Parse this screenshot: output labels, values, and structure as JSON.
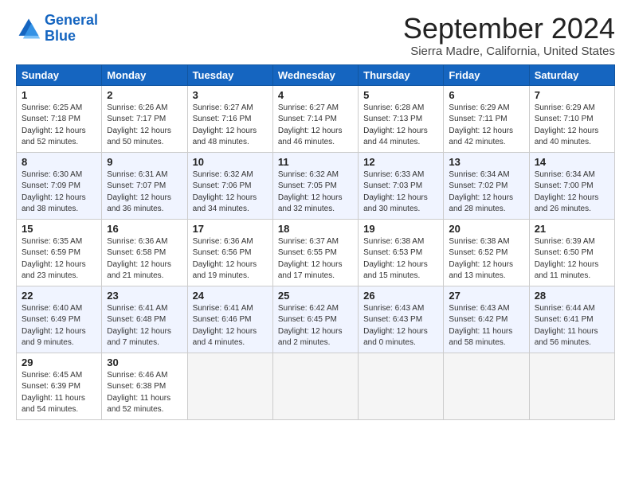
{
  "header": {
    "logo_line1": "General",
    "logo_line2": "Blue",
    "month": "September 2024",
    "location": "Sierra Madre, California, United States"
  },
  "days_of_week": [
    "Sunday",
    "Monday",
    "Tuesday",
    "Wednesday",
    "Thursday",
    "Friday",
    "Saturday"
  ],
  "weeks": [
    [
      {
        "num": "1",
        "rise": "6:25 AM",
        "set": "7:18 PM",
        "daylight": "12 hours and 52 minutes."
      },
      {
        "num": "2",
        "rise": "6:26 AM",
        "set": "7:17 PM",
        "daylight": "12 hours and 50 minutes."
      },
      {
        "num": "3",
        "rise": "6:27 AM",
        "set": "7:16 PM",
        "daylight": "12 hours and 48 minutes."
      },
      {
        "num": "4",
        "rise": "6:27 AM",
        "set": "7:14 PM",
        "daylight": "12 hours and 46 minutes."
      },
      {
        "num": "5",
        "rise": "6:28 AM",
        "set": "7:13 PM",
        "daylight": "12 hours and 44 minutes."
      },
      {
        "num": "6",
        "rise": "6:29 AM",
        "set": "7:11 PM",
        "daylight": "12 hours and 42 minutes."
      },
      {
        "num": "7",
        "rise": "6:29 AM",
        "set": "7:10 PM",
        "daylight": "12 hours and 40 minutes."
      }
    ],
    [
      {
        "num": "8",
        "rise": "6:30 AM",
        "set": "7:09 PM",
        "daylight": "12 hours and 38 minutes."
      },
      {
        "num": "9",
        "rise": "6:31 AM",
        "set": "7:07 PM",
        "daylight": "12 hours and 36 minutes."
      },
      {
        "num": "10",
        "rise": "6:32 AM",
        "set": "7:06 PM",
        "daylight": "12 hours and 34 minutes."
      },
      {
        "num": "11",
        "rise": "6:32 AM",
        "set": "7:05 PM",
        "daylight": "12 hours and 32 minutes."
      },
      {
        "num": "12",
        "rise": "6:33 AM",
        "set": "7:03 PM",
        "daylight": "12 hours and 30 minutes."
      },
      {
        "num": "13",
        "rise": "6:34 AM",
        "set": "7:02 PM",
        "daylight": "12 hours and 28 minutes."
      },
      {
        "num": "14",
        "rise": "6:34 AM",
        "set": "7:00 PM",
        "daylight": "12 hours and 26 minutes."
      }
    ],
    [
      {
        "num": "15",
        "rise": "6:35 AM",
        "set": "6:59 PM",
        "daylight": "12 hours and 23 minutes."
      },
      {
        "num": "16",
        "rise": "6:36 AM",
        "set": "6:58 PM",
        "daylight": "12 hours and 21 minutes."
      },
      {
        "num": "17",
        "rise": "6:36 AM",
        "set": "6:56 PM",
        "daylight": "12 hours and 19 minutes."
      },
      {
        "num": "18",
        "rise": "6:37 AM",
        "set": "6:55 PM",
        "daylight": "12 hours and 17 minutes."
      },
      {
        "num": "19",
        "rise": "6:38 AM",
        "set": "6:53 PM",
        "daylight": "12 hours and 15 minutes."
      },
      {
        "num": "20",
        "rise": "6:38 AM",
        "set": "6:52 PM",
        "daylight": "12 hours and 13 minutes."
      },
      {
        "num": "21",
        "rise": "6:39 AM",
        "set": "6:50 PM",
        "daylight": "12 hours and 11 minutes."
      }
    ],
    [
      {
        "num": "22",
        "rise": "6:40 AM",
        "set": "6:49 PM",
        "daylight": "12 hours and 9 minutes."
      },
      {
        "num": "23",
        "rise": "6:41 AM",
        "set": "6:48 PM",
        "daylight": "12 hours and 7 minutes."
      },
      {
        "num": "24",
        "rise": "6:41 AM",
        "set": "6:46 PM",
        "daylight": "12 hours and 4 minutes."
      },
      {
        "num": "25",
        "rise": "6:42 AM",
        "set": "6:45 PM",
        "daylight": "12 hours and 2 minutes."
      },
      {
        "num": "26",
        "rise": "6:43 AM",
        "set": "6:43 PM",
        "daylight": "12 hours and 0 minutes."
      },
      {
        "num": "27",
        "rise": "6:43 AM",
        "set": "6:42 PM",
        "daylight": "11 hours and 58 minutes."
      },
      {
        "num": "28",
        "rise": "6:44 AM",
        "set": "6:41 PM",
        "daylight": "11 hours and 56 minutes."
      }
    ],
    [
      {
        "num": "29",
        "rise": "6:45 AM",
        "set": "6:39 PM",
        "daylight": "11 hours and 54 minutes."
      },
      {
        "num": "30",
        "rise": "6:46 AM",
        "set": "6:38 PM",
        "daylight": "11 hours and 52 minutes."
      },
      null,
      null,
      null,
      null,
      null
    ]
  ]
}
